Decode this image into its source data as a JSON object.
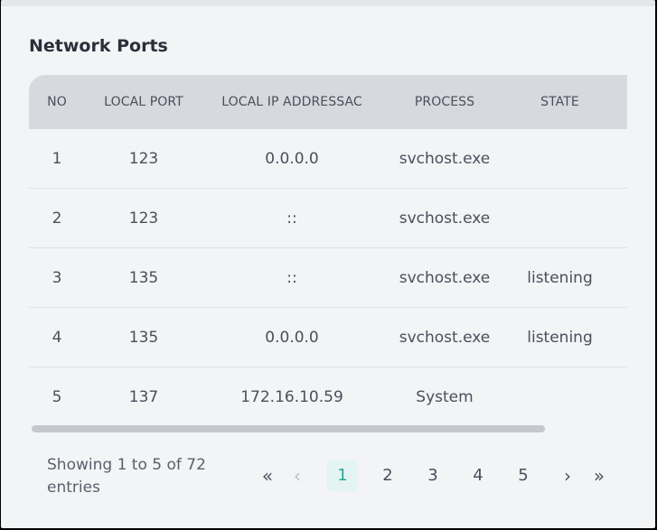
{
  "section": {
    "title": "Network Ports"
  },
  "table": {
    "columns": [
      "NO",
      "LOCAL PORT",
      "LOCAL IP ADDRESSAC",
      "PROCESS",
      "STATE"
    ],
    "rows": [
      {
        "no": "1",
        "port": "123",
        "ip": "0.0.0.0",
        "process": "svchost.exe",
        "state": ""
      },
      {
        "no": "2",
        "port": "123",
        "ip": "::",
        "process": "svchost.exe",
        "state": ""
      },
      {
        "no": "3",
        "port": "135",
        "ip": "::",
        "process": "svchost.exe",
        "state": "listening"
      },
      {
        "no": "4",
        "port": "135",
        "ip": "0.0.0.0",
        "process": "svchost.exe",
        "state": "listening"
      },
      {
        "no": "5",
        "port": "137",
        "ip": "172.16.10.59",
        "process": "System",
        "state": ""
      }
    ]
  },
  "pagination": {
    "summary": "Showing 1 to 5 of 72 entries",
    "first_icon": "«",
    "prev_icon": "‹",
    "pages": [
      "1",
      "2",
      "3",
      "4",
      "5"
    ],
    "current_page": "1",
    "next_icon": "›",
    "last_icon": "»"
  },
  "colors": {
    "accent": "#2aa79b",
    "active_bg": "#e3f4f3",
    "header_bg": "#d7d9de"
  }
}
